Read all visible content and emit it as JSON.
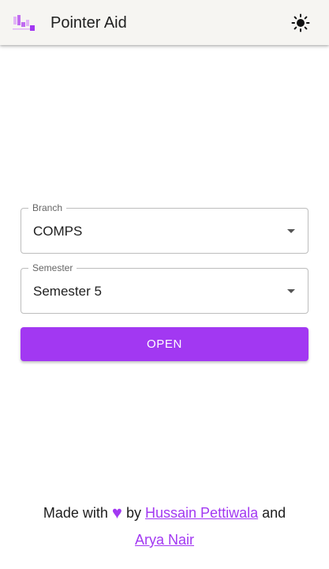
{
  "header": {
    "title": "Pointer Aid",
    "logo_icon": "bar-chart-logo-icon",
    "theme_toggle_icon": "sun-icon"
  },
  "form": {
    "branch": {
      "label": "Branch",
      "value": "COMPS"
    },
    "semester": {
      "label": "Semester",
      "value": "Semester 5"
    },
    "open_label": "OPEN"
  },
  "footer": {
    "made_with": "Made with",
    "heart": "♥",
    "by": "by",
    "author1": "Hussain Pettiwala",
    "and": "and",
    "author2": "Arya Nair"
  },
  "colors": {
    "accent": "#a238f2",
    "header_bg": "#f6f5f2",
    "logo_light": "#e2b3f7",
    "logo_mid": "#c06cf0"
  }
}
